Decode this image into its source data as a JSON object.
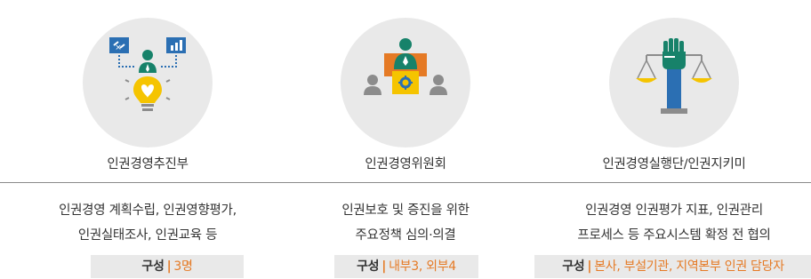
{
  "columns": [
    {
      "icon": "team-strategy-lightbulb-icon",
      "title": "인권경영추진부",
      "desc_lines": [
        "인권경영 계획수립, 인권영향평가,",
        "인권실태조사, 인권교육 등"
      ],
      "composition_label": "구성",
      "composition_separator": "|",
      "composition_value": "3명"
    },
    {
      "icon": "committee-meeting-icon",
      "title": "인권경영위원회",
      "desc_lines": [
        "인권보호 및 증진을 위한",
        "주요정책 심의·의결"
      ],
      "composition_label": "구성",
      "composition_separator": "|",
      "composition_value": "내부3, 외부4"
    },
    {
      "icon": "justice-fist-scale-icon",
      "title": "인권경영실행단/인권지키미",
      "desc_lines": [
        "인권경영 인권평가 지표, 인권관리",
        "프로세스 등 주요시스템 확정 전 협의"
      ],
      "composition_label": "구성",
      "composition_separator": "|",
      "composition_value": "본사, 부설기관, 지역본부 인권 담당자"
    }
  ],
  "colors": {
    "orange": "#e57a25",
    "yellow": "#f5c400",
    "blue": "#2b6fb3",
    "green": "#17826a",
    "gray": "#8c8c8c",
    "circle_bg": "#e9e9e9",
    "divider": "#8a8a8a"
  }
}
